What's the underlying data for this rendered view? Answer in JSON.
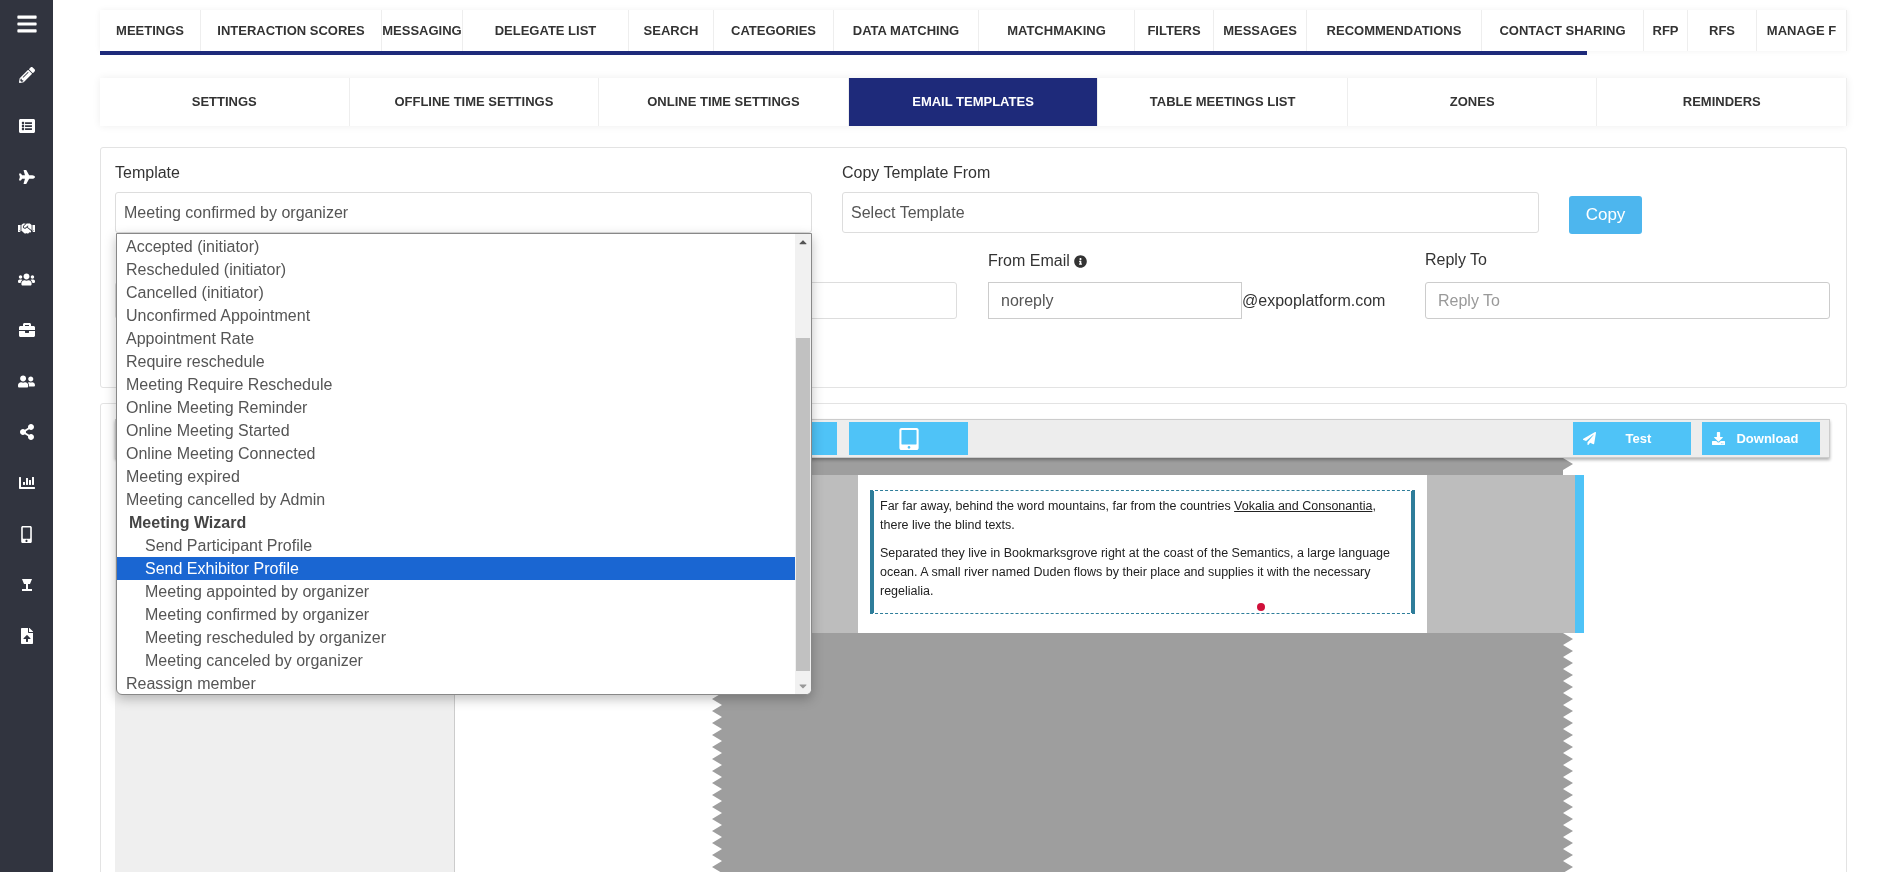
{
  "top_tabs": [
    {
      "label": "MEETINGS",
      "selected": false
    },
    {
      "label": "INTERACTION SCORES",
      "selected": false
    },
    {
      "label": "MESSAGING",
      "selected": false
    },
    {
      "label": "DELEGATE LIST",
      "selected": false
    },
    {
      "label": "SEARCH",
      "selected": false
    },
    {
      "label": "CATEGORIES",
      "selected": false
    },
    {
      "label": "DATA MATCHING",
      "selected": false
    },
    {
      "label": "MATCHMAKING",
      "selected": false
    },
    {
      "label": "FILTERS",
      "selected": false
    },
    {
      "label": "MESSAGES",
      "selected": false
    },
    {
      "label": "RECOMMENDATIONS",
      "selected": false
    },
    {
      "label": "CONTACT SHARING",
      "selected": false
    },
    {
      "label": "RFP",
      "selected": false
    },
    {
      "label": "RFS",
      "selected": false
    },
    {
      "label": "MANAGE F",
      "selected": false
    }
  ],
  "sub_tabs": [
    {
      "label": "SETTINGS",
      "selected": false
    },
    {
      "label": "OFFLINE TIME SETTINGS",
      "selected": false
    },
    {
      "label": "ONLINE TIME SETTINGS",
      "selected": false
    },
    {
      "label": "EMAIL TEMPLATES",
      "selected": true
    },
    {
      "label": "TABLE MEETINGS LIST",
      "selected": false
    },
    {
      "label": "ZONES",
      "selected": false
    },
    {
      "label": "REMINDERS",
      "selected": false
    }
  ],
  "template": {
    "label": "Template",
    "value": "Meeting confirmed by organizer"
  },
  "copy_from": {
    "label": "Copy Template From",
    "placeholder": "Select Template",
    "button": "Copy"
  },
  "from_email": {
    "label": "From Email",
    "value": "noreply",
    "domain": "@expoplatform.com"
  },
  "reply_to": {
    "label": "Reply To",
    "placeholder": "Reply To"
  },
  "template_options": [
    {
      "kind": "option",
      "label": "Accepted (initiator)",
      "selected": false
    },
    {
      "kind": "option",
      "label": "Rescheduled (initiator)",
      "selected": false
    },
    {
      "kind": "option",
      "label": "Cancelled (initiator)",
      "selected": false
    },
    {
      "kind": "option",
      "label": "Unconfirmed Appointment",
      "selected": false
    },
    {
      "kind": "option",
      "label": "Appointment Rate",
      "selected": false
    },
    {
      "kind": "option",
      "label": "Require reschedule",
      "selected": false
    },
    {
      "kind": "option",
      "label": "Meeting Require Reschedule",
      "selected": false
    },
    {
      "kind": "option",
      "label": "Online Meeting Reminder",
      "selected": false
    },
    {
      "kind": "option",
      "label": "Online Meeting Started",
      "selected": false
    },
    {
      "kind": "option",
      "label": "Online Meeting Connected",
      "selected": false
    },
    {
      "kind": "option",
      "label": "Meeting expired",
      "selected": false
    },
    {
      "kind": "option",
      "label": "Meeting cancelled by Admin",
      "selected": false
    },
    {
      "kind": "group",
      "label": "Meeting Wizard",
      "children": [
        {
          "kind": "option",
          "label": "Send Participant Profile",
          "selected": false
        },
        {
          "kind": "option",
          "label": "Send Exhibitor Profile",
          "selected": true
        },
        {
          "kind": "option",
          "label": "Meeting appointed by organizer",
          "selected": false
        },
        {
          "kind": "option",
          "label": "Meeting confirmed by organizer",
          "selected": false
        },
        {
          "kind": "option",
          "label": "Meeting rescheduled by organizer",
          "selected": false
        },
        {
          "kind": "option",
          "label": "Meeting canceled by organizer",
          "selected": false
        }
      ]
    },
    {
      "kind": "option",
      "label": "Reassign member",
      "selected": false
    }
  ],
  "preview_toolbar": {
    "buttons": [
      {
        "kind": "test",
        "label": "Test"
      },
      {
        "kind": "download",
        "label": "Download"
      }
    ]
  },
  "email_body": {
    "paragraphs": [
      {
        "before": "Far far away, behind the word mountains, far from the countries ",
        "link": "Vokalia and Consonantia",
        "after": ", there live the blind texts."
      },
      {
        "before": "Separated they live in Bookmarksgrove right at the coast of the Semantics, a large language ocean. A small river named Duden flows by their place and supplies it with the necessary regelialia."
      }
    ]
  }
}
